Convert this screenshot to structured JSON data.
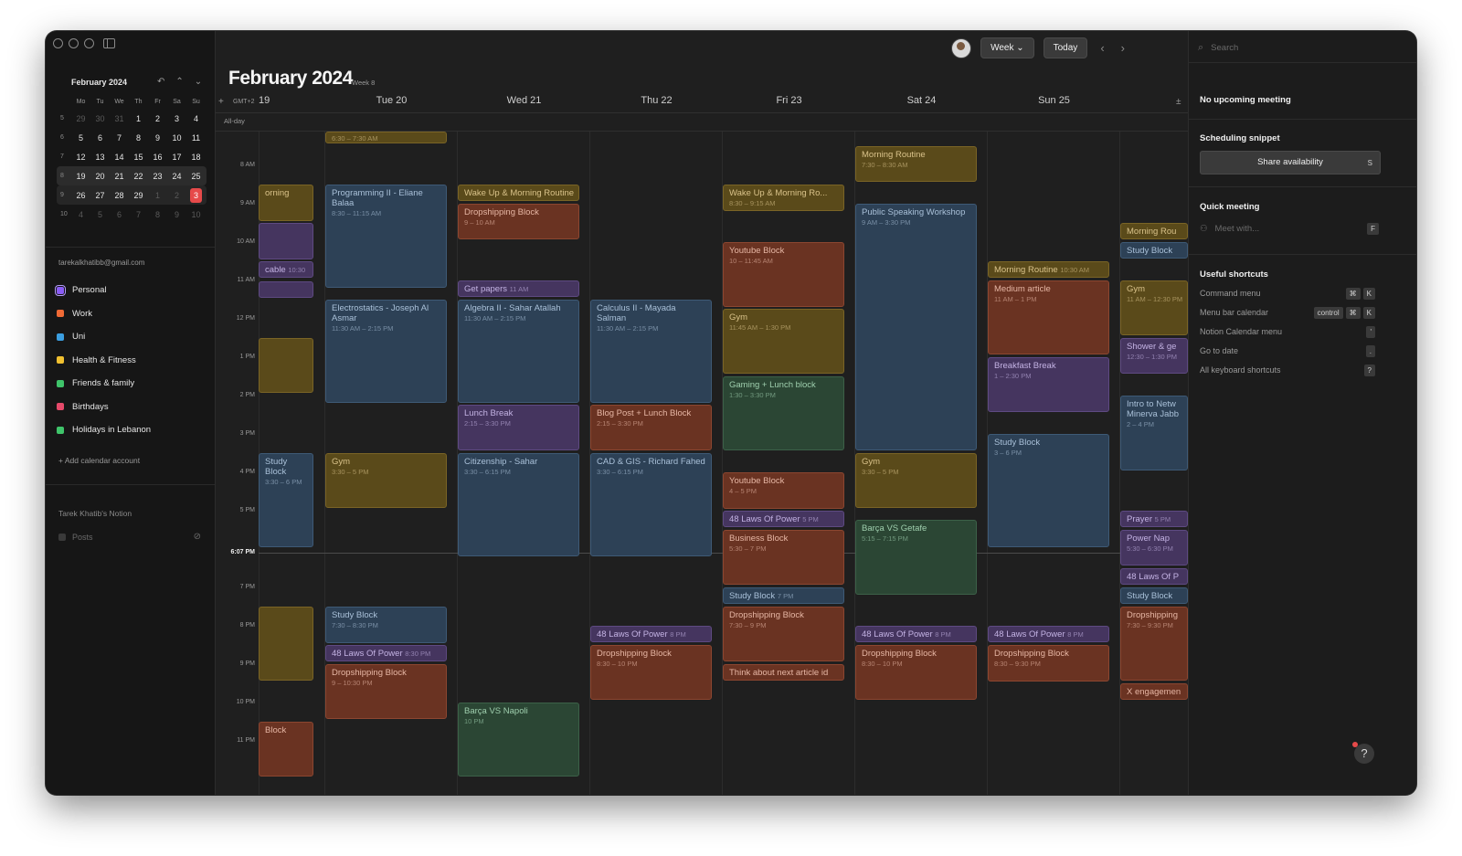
{
  "sidebar": {
    "mini_month": "February 2024",
    "weekday_headers": [
      "Mo",
      "Tu",
      "We",
      "Th",
      "Fr",
      "Sa",
      "Su"
    ],
    "weeks": [
      {
        "wk": "5",
        "days": [
          "29",
          "30",
          "31",
          "1",
          "2",
          "3",
          "4"
        ]
      },
      {
        "wk": "6",
        "days": [
          "5",
          "6",
          "7",
          "8",
          "9",
          "10",
          "11"
        ]
      },
      {
        "wk": "7",
        "days": [
          "12",
          "13",
          "14",
          "15",
          "16",
          "17",
          "18"
        ]
      },
      {
        "wk": "8",
        "days": [
          "19",
          "20",
          "21",
          "22",
          "23",
          "24",
          "25"
        ]
      },
      {
        "wk": "9",
        "days": [
          "26",
          "27",
          "28",
          "29",
          "1",
          "2",
          "3"
        ]
      },
      {
        "wk": "10",
        "days": [
          "4",
          "5",
          "6",
          "7",
          "8",
          "9",
          "10"
        ]
      }
    ],
    "account_email": "tarekalkhatibb@gmail.com",
    "calendars": [
      {
        "label": "Personal",
        "color": "#8a5cf6"
      },
      {
        "label": "Work",
        "color": "#f06a35"
      },
      {
        "label": "Uni",
        "color": "#3b9ee0"
      },
      {
        "label": "Health & Fitness",
        "color": "#f0c030"
      },
      {
        "label": "Friends & family",
        "color": "#3fc46a"
      },
      {
        "label": "Birthdays",
        "color": "#e64a6a"
      },
      {
        "label": "Holidays in Lebanon",
        "color": "#3fc46a"
      }
    ],
    "add_account": "Add calendar account",
    "notion_header": "Tarek Khatib's Notion",
    "posts_label": "Posts"
  },
  "header": {
    "title": "February 2024",
    "week_label": "Week 8",
    "view_select": "Week",
    "today_button": "Today",
    "timezone": "GMT+2",
    "all_day": "All-day",
    "days": [
      "19",
      "Tue 20",
      "Wed 21",
      "Thu 22",
      "Fri 23",
      "Sat 24",
      "Sun 25"
    ]
  },
  "hours": [
    "8 AM",
    "9 AM",
    "10 AM",
    "11 AM",
    "12 PM",
    "1 PM",
    "2 PM",
    "3 PM",
    "4 PM",
    "5 PM",
    "7 PM",
    "8 PM",
    "9 PM",
    "10 PM",
    "11 PM"
  ],
  "now_label": "6:07 PM",
  "events": [
    {
      "title": "",
      "time": "6:30 – 7:30 AM",
      "color": "yellow"
    },
    {
      "title": "orning",
      "time": "",
      "color": "yellow"
    },
    {
      "title": "",
      "time": "",
      "color": "purple"
    },
    {
      "title": "cable",
      "time": "10:30 ...",
      "color": "purple"
    },
    {
      "title": "",
      "time": "",
      "color": "purple"
    },
    {
      "title": "",
      "time": "",
      "color": "yellow"
    },
    {
      "title": "Study Block",
      "time": "3:30 – 6 PM",
      "color": "blue"
    },
    {
      "title": "",
      "time": "",
      "color": "yellow"
    },
    {
      "title": "Block",
      "time": "",
      "color": "red"
    },
    {
      "title": "Programming II - Eliane Balaa",
      "time": "8:30 – 11:15 AM",
      "color": "blue"
    },
    {
      "title": "Electrostatics - Joseph Al Asmar",
      "time": "11:30 AM – 2:15 PM",
      "color": "blue"
    },
    {
      "title": "Gym",
      "time": "3:30 – 5 PM",
      "color": "yellow"
    },
    {
      "title": "Study Block",
      "time": "7:30 – 8:30 PM",
      "color": "blue"
    },
    {
      "title": "48 Laws Of Power",
      "time": "8:30 PM",
      "color": "purple"
    },
    {
      "title": "Dropshipping Block",
      "time": "9 – 10:30 PM",
      "color": "red"
    },
    {
      "title": "Wake Up & Morning Routine",
      "time": "",
      "color": "yellow"
    },
    {
      "title": "Dropshipping Block",
      "time": "9 – 10 AM",
      "color": "red"
    },
    {
      "title": "Get papers",
      "time": "11 AM",
      "color": "purple"
    },
    {
      "title": "Algebra II - Sahar Atallah",
      "time": "11:30 AM – 2:15 PM",
      "color": "blue"
    },
    {
      "title": "Lunch Break",
      "time": "2:15 – 3:30 PM",
      "color": "purple"
    },
    {
      "title": "Citizenship - Sahar",
      "time": "3:30 – 6:15 PM",
      "color": "blue"
    },
    {
      "title": "Barça VS Napoli",
      "time": "10 PM",
      "color": "green"
    },
    {
      "title": "Calculus II - Mayada Salman",
      "time": "11:30 AM – 2:15 PM",
      "color": "blue"
    },
    {
      "title": "Blog Post + Lunch Block",
      "time": "2:15 – 3:30 PM",
      "color": "red"
    },
    {
      "title": "CAD & GIS - Richard Fahed",
      "time": "3:30 – 6:15 PM",
      "color": "blue"
    },
    {
      "title": "48 Laws Of Power",
      "time": "8 PM",
      "color": "purple"
    },
    {
      "title": "Dropshipping Block",
      "time": "8:30 – 10 PM",
      "color": "red"
    },
    {
      "title": "Wake Up & Morning Ro...",
      "time": "8:30 – 9:15 AM",
      "color": "yellow"
    },
    {
      "title": "Youtube Block",
      "time": "10 – 11:45 AM",
      "color": "red"
    },
    {
      "title": "Gym",
      "time": "11:45 AM – 1:30 PM",
      "color": "yellow"
    },
    {
      "title": "Gaming + Lunch block",
      "time": "1:30 – 3:30 PM",
      "color": "green"
    },
    {
      "title": "Youtube Block",
      "time": "4 – 5 PM",
      "color": "red"
    },
    {
      "title": "48 Laws Of Power",
      "time": "5 PM",
      "color": "purple"
    },
    {
      "title": "Business Block",
      "time": "5:30 – 7 PM",
      "color": "red"
    },
    {
      "title": "Study Block",
      "time": "7 PM",
      "color": "blue"
    },
    {
      "title": "Dropshipping Block",
      "time": "7:30 – 9 PM",
      "color": "red"
    },
    {
      "title": "Think about next article id",
      "time": "",
      "color": "red"
    },
    {
      "title": "Morning Routine",
      "time": "7:30 – 8:30 AM",
      "color": "yellow"
    },
    {
      "title": "Public Speaking Workshop",
      "time": "9 AM – 3:30 PM",
      "color": "blue"
    },
    {
      "title": "Gym",
      "time": "3:30 – 5 PM",
      "color": "yellow"
    },
    {
      "title": "Barça VS Getafe",
      "time": "5:15 – 7:15 PM",
      "color": "green"
    },
    {
      "title": "48 Laws Of Power",
      "time": "8 PM",
      "color": "purple"
    },
    {
      "title": "Dropshipping Block",
      "time": "8:30 – 10 PM",
      "color": "red"
    },
    {
      "title": "Morning Routine",
      "time": "10:30 AM",
      "color": "yellow"
    },
    {
      "title": "Medium article",
      "time": "11 AM – 1 PM",
      "color": "red"
    },
    {
      "title": "Breakfast Break",
      "time": "1 – 2:30 PM",
      "color": "purple"
    },
    {
      "title": "Study Block",
      "time": "3 – 6 PM",
      "color": "blue"
    },
    {
      "title": "48 Laws Of Power",
      "time": "8 PM",
      "color": "purple"
    },
    {
      "title": "Dropshipping Block",
      "time": "8:30 – 9:30 PM",
      "color": "red"
    },
    {
      "title": "Morning Rou",
      "time": "",
      "color": "yellow"
    },
    {
      "title": "Study Block",
      "time": "",
      "color": "blue"
    },
    {
      "title": "Gym",
      "time": "11 AM – 12:30 PM",
      "color": "yellow"
    },
    {
      "title": "Shower & ge",
      "time": "12:30 – 1:30 PM",
      "color": "purple"
    },
    {
      "title": "Intro to Netw Minerva Jabb",
      "time": "2 – 4 PM",
      "color": "blue"
    },
    {
      "title": "Prayer",
      "time": "5 PM",
      "color": "purple"
    },
    {
      "title": "Power Nap",
      "time": "5:30 – 6:30 PM",
      "color": "purple"
    },
    {
      "title": "48 Laws Of P",
      "time": "",
      "color": "purple"
    },
    {
      "title": "Study Block",
      "time": "",
      "color": "blue"
    },
    {
      "title": "Dropshipping",
      "time": "7:30 – 9:30 PM",
      "color": "red"
    },
    {
      "title": "X engagemen",
      "time": "",
      "color": "red"
    }
  ],
  "right_panel": {
    "search_placeholder": "Search",
    "no_meeting": "No upcoming meeting",
    "scheduling_title": "Scheduling snippet",
    "share_label": "Share availability",
    "share_key": "S",
    "quick_meeting_title": "Quick meeting",
    "meet_placeholder": "Meet with...",
    "meet_key": "F",
    "shortcuts_title": "Useful shortcuts",
    "shortcuts": [
      {
        "label": "Command menu",
        "keys": [
          "⌘",
          "K"
        ]
      },
      {
        "label": "Menu bar calendar",
        "keys": [
          "control",
          "⌘",
          "K"
        ]
      },
      {
        "label": "Notion Calendar menu",
        "keys": [
          "'"
        ]
      },
      {
        "label": "Go to date",
        "keys": [
          "."
        ]
      },
      {
        "label": "All keyboard shortcuts",
        "keys": [
          "?"
        ]
      }
    ]
  },
  "help_label": "?"
}
